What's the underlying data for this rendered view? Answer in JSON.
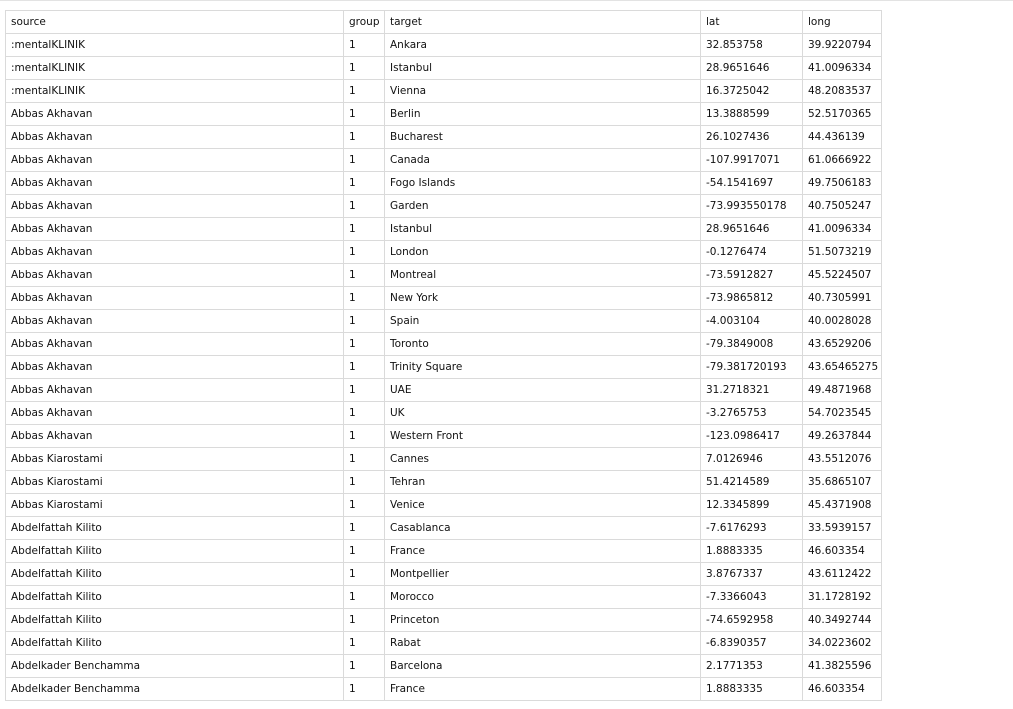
{
  "table": {
    "headers": [
      "source",
      "group",
      "target",
      "lat",
      "long"
    ],
    "rows": [
      [
        ":mentalKLINIK",
        "1",
        "Ankara",
        "32.853758",
        "39.9220794"
      ],
      [
        ":mentalKLINIK",
        "1",
        "Istanbul",
        "28.9651646",
        "41.0096334"
      ],
      [
        ":mentalKLINIK",
        "1",
        "Vienna",
        "16.3725042",
        "48.2083537"
      ],
      [
        "Abbas Akhavan",
        "1",
        "Berlin",
        "13.3888599",
        "52.5170365"
      ],
      [
        "Abbas Akhavan",
        "1",
        "Bucharest",
        "26.1027436",
        "44.436139"
      ],
      [
        "Abbas Akhavan",
        "1",
        "Canada",
        "-107.9917071",
        "61.0666922"
      ],
      [
        "Abbas Akhavan",
        "1",
        "Fogo Islands",
        "-54.1541697",
        "49.7506183"
      ],
      [
        "Abbas Akhavan",
        "1",
        "Garden",
        "-73.993550178",
        "40.7505247"
      ],
      [
        "Abbas Akhavan",
        "1",
        "Istanbul",
        "28.9651646",
        "41.0096334"
      ],
      [
        "Abbas Akhavan",
        "1",
        "London",
        "-0.1276474",
        "51.5073219"
      ],
      [
        "Abbas Akhavan",
        "1",
        "Montreal",
        "-73.5912827",
        "45.5224507"
      ],
      [
        "Abbas Akhavan",
        "1",
        "New York",
        "-73.9865812",
        "40.7305991"
      ],
      [
        "Abbas Akhavan",
        "1",
        "Spain",
        "-4.003104",
        "40.0028028"
      ],
      [
        "Abbas Akhavan",
        "1",
        "Toronto",
        "-79.3849008",
        "43.6529206"
      ],
      [
        "Abbas Akhavan",
        "1",
        "Trinity Square",
        "-79.381720193",
        "43.65465275"
      ],
      [
        "Abbas Akhavan",
        "1",
        "UAE",
        "31.2718321",
        "49.4871968"
      ],
      [
        "Abbas Akhavan",
        "1",
        "UK",
        "-3.2765753",
        "54.7023545"
      ],
      [
        "Abbas Akhavan",
        "1",
        "Western Front",
        "-123.0986417",
        "49.2637844"
      ],
      [
        "Abbas Kiarostami",
        "1",
        "Cannes",
        "7.0126946",
        "43.5512076"
      ],
      [
        "Abbas Kiarostami",
        "1",
        "Tehran",
        "51.4214589",
        "35.6865107"
      ],
      [
        "Abbas Kiarostami",
        "1",
        "Venice",
        "12.3345899",
        "45.4371908"
      ],
      [
        "Abdelfattah Kilito",
        "1",
        "Casablanca",
        "-7.6176293",
        "33.5939157"
      ],
      [
        "Abdelfattah Kilito",
        "1",
        "France",
        "1.8883335",
        "46.603354"
      ],
      [
        "Abdelfattah Kilito",
        "1",
        "Montpellier",
        "3.8767337",
        "43.6112422"
      ],
      [
        "Abdelfattah Kilito",
        "1",
        "Morocco",
        "-7.3366043",
        "31.1728192"
      ],
      [
        "Abdelfattah Kilito",
        "1",
        "Princeton",
        "-74.6592958",
        "40.3492744"
      ],
      [
        "Abdelfattah Kilito",
        "1",
        "Rabat",
        "-6.8390357",
        "34.0223602"
      ],
      [
        "Abdelkader Benchamma",
        "1",
        "Barcelona",
        "2.1771353",
        "41.3825596"
      ],
      [
        "Abdelkader Benchamma",
        "1",
        "France",
        "1.8883335",
        "46.603354"
      ]
    ]
  }
}
